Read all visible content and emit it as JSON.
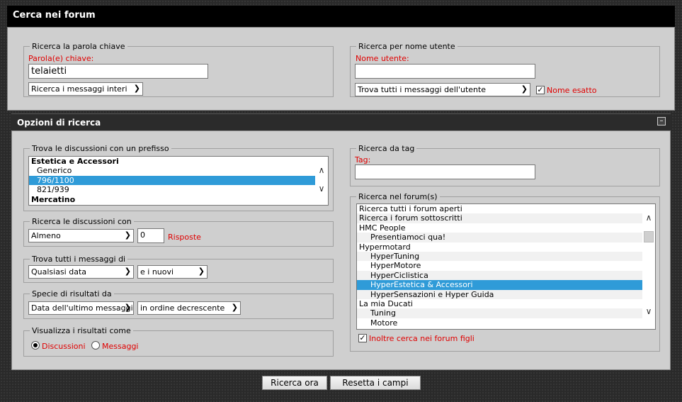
{
  "header": {
    "title": "Cerca nei forum"
  },
  "keyword": {
    "legend": "Ricerca la parola chiave",
    "label": "Parola(e) chiave:",
    "value": "telaietti",
    "mode_select": "Ricerca i messaggi interi"
  },
  "user": {
    "legend": "Ricerca per nome utente",
    "label": "Nome utente:",
    "value": "",
    "mode_select": "Trova tutti i messaggi dell'utente",
    "exact_label": "Nome esatto",
    "exact_checked": true
  },
  "options": {
    "title": "Opzioni di ricerca",
    "collapse_icon": "minus-icon"
  },
  "prefix": {
    "legend": "Trova le discussioni con un prefisso",
    "items": [
      {
        "label": "Estetica e Accessori",
        "style": "group"
      },
      {
        "label": "Generico",
        "style": "child"
      },
      {
        "label": "796/1100",
        "style": "child-selected"
      },
      {
        "label": "821/939",
        "style": "child"
      },
      {
        "label": "Mercatino",
        "style": "group"
      }
    ]
  },
  "replies": {
    "legend": "Ricerca le discussioni con",
    "select": "Almeno",
    "value": "0",
    "label": "Risposte"
  },
  "date": {
    "legend": "Trova tutti i messaggi di",
    "select": "Qualsiasi data",
    "direction": "e i nuovi"
  },
  "sort": {
    "legend": "Specie di risultati da",
    "select": "Data dell'ultimo messaggio",
    "order": "in ordine decrescente"
  },
  "display": {
    "legend": "Visualizza i risultati come",
    "opt1": "Discussioni",
    "opt2": "Messaggi",
    "selected": "Discussioni"
  },
  "tag": {
    "legend": "Ricerca da tag",
    "label": "Tag:",
    "value": ""
  },
  "forums": {
    "legend": "Ricerca nel forum(s)",
    "items": [
      {
        "label": "Ricerca tutti i forum aperti",
        "level": 0
      },
      {
        "label": "Ricerca i forum sottoscritti",
        "level": 0
      },
      {
        "label": "HMC People",
        "level": 0
      },
      {
        "label": "Presentiamoci qua!",
        "level": 1
      },
      {
        "label": "Hypermotard",
        "level": 0
      },
      {
        "label": "HyperTuning",
        "level": 1
      },
      {
        "label": "HyperMotore",
        "level": 1
      },
      {
        "label": "HyperCiclistica",
        "level": 1
      },
      {
        "label": "HyperEstetica & Accessori",
        "level": 1,
        "selected": true
      },
      {
        "label": "HyperSensazioni e Hyper Guida",
        "level": 1
      },
      {
        "label": "La mia Ducati",
        "level": 0
      },
      {
        "label": "Tuning",
        "level": 1
      },
      {
        "label": "Motore",
        "level": 1
      }
    ],
    "child_label": "Inoltre cerca nei forum figli",
    "child_checked": true
  },
  "buttons": {
    "search": "Ricerca ora",
    "reset": "Resetta i campi"
  }
}
